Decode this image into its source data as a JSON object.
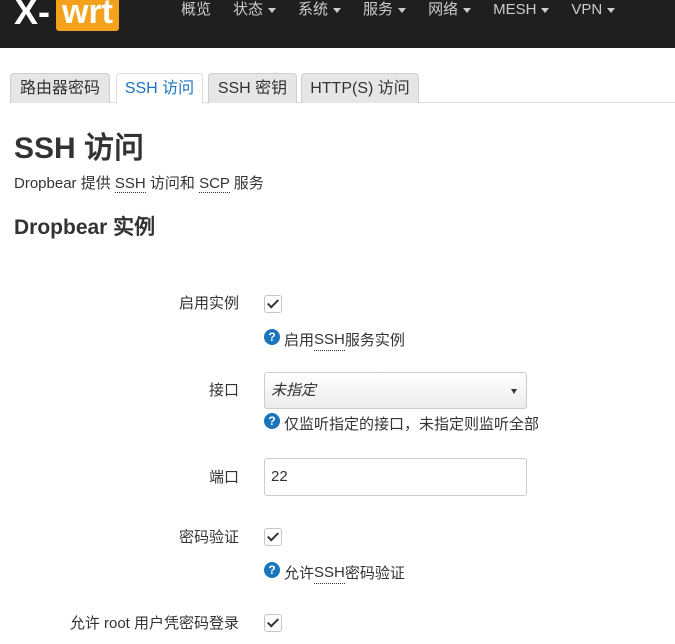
{
  "brand": {
    "logo_x": "X-",
    "logo_wrt": "wrt"
  },
  "nav": [
    {
      "label": "概览",
      "dropdown": false
    },
    {
      "label": "状态",
      "dropdown": true
    },
    {
      "label": "系统",
      "dropdown": true
    },
    {
      "label": "服务",
      "dropdown": true
    },
    {
      "label": "网络",
      "dropdown": true
    },
    {
      "label": "MESH",
      "dropdown": true
    },
    {
      "label": "VPN",
      "dropdown": true
    }
  ],
  "tabs": [
    {
      "label": "路由器密码",
      "active": false
    },
    {
      "label": "SSH 访问",
      "active": true
    },
    {
      "label": "SSH 密钥",
      "active": false
    },
    {
      "label": "HTTP(S) 访问",
      "active": false
    }
  ],
  "page": {
    "title": "SSH 访问",
    "desc_part1": "Dropbear 提供 ",
    "desc_abbr1": "SSH",
    "desc_part2": " 访问和 ",
    "desc_abbr2": "SCP",
    "desc_part3": " 服务"
  },
  "section": {
    "title": "Dropbear 实例"
  },
  "fields": {
    "enable": {
      "label": "启用实例",
      "checked": true,
      "help_part1": "启用 ",
      "help_abbr": "SSH",
      "help_part2": " 服务实例"
    },
    "interface": {
      "label": "接口",
      "value": "未指定",
      "help": "仅监听指定的接口，未指定则监听全部"
    },
    "port": {
      "label": "端口",
      "value": "22"
    },
    "password_auth": {
      "label": "密码验证",
      "checked": true,
      "help_part1": "允许 ",
      "help_abbr": "SSH",
      "help_part2": " 密码验证"
    },
    "root_password": {
      "label": "允许 root 用户凭密码登录",
      "checked": true
    }
  },
  "colors": {
    "accent": "#1b75bc",
    "topbar": "#1f1f1f",
    "logo_orange": "#f4a21b"
  },
  "icons": {
    "help": "question-circle-icon",
    "check": "checkmark-icon",
    "dropdown": "caret-down-icon"
  }
}
